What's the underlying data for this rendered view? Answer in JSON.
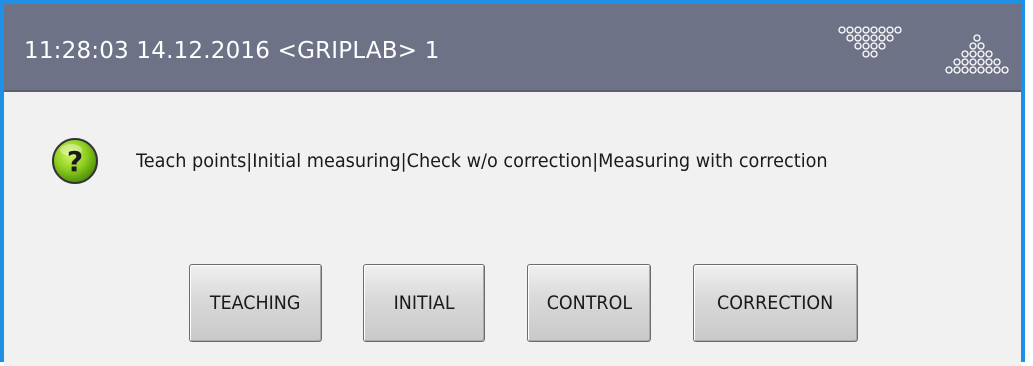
{
  "header": {
    "title": "11:28:03 14.12.2016 <GRIPLAB> 1",
    "background_color": "#6e7287",
    "logos": [
      "dot-pattern-logo-downward",
      "dot-pattern-logo-upward"
    ]
  },
  "dialog": {
    "icon": "question-icon",
    "icon_color": "#7cc916",
    "message": "Teach points|Initial measuring|Check w/o correction|Measuring with correction"
  },
  "buttons": {
    "teaching": "TEACHING",
    "initial": "INITIAL",
    "control": "CONTROL",
    "correction": "CORRECTION"
  },
  "colors": {
    "window_border": "#1e90e6",
    "content_background": "#f1f1f1"
  }
}
